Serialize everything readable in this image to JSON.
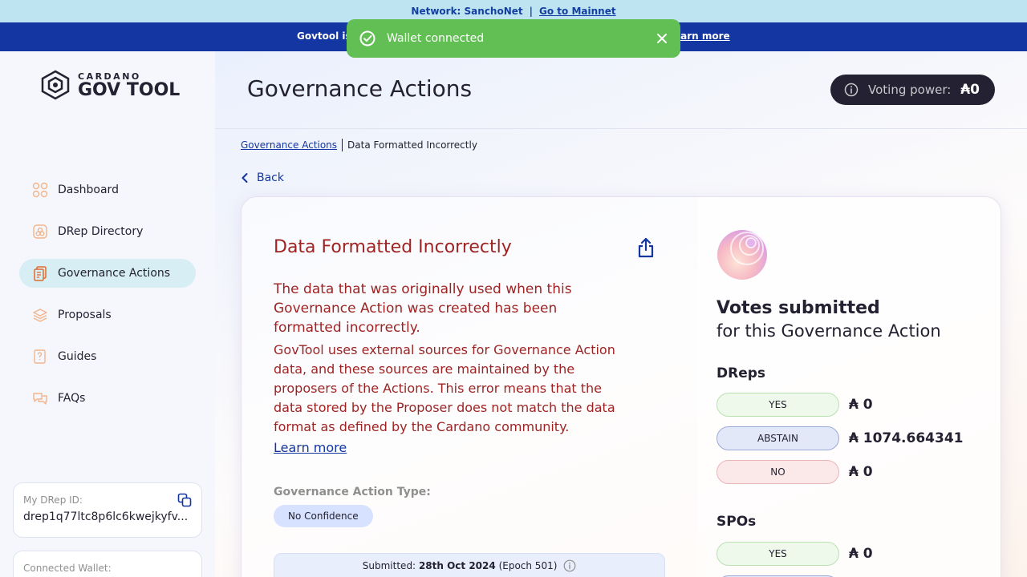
{
  "network_bar": {
    "text": "Network: SanchoNet",
    "separator": "|",
    "link": "Go to Mainnet"
  },
  "banner": {
    "text_left": "Govtool is",
    "text_right": "earn more"
  },
  "toast": {
    "message": "Wallet connected",
    "color": "#62bf54"
  },
  "logo": {
    "top": "CARDANO",
    "bottom": "GOV TOOL"
  },
  "sidebar": {
    "items": [
      {
        "label": "Dashboard",
        "icon": "dashboard-icon",
        "active": false
      },
      {
        "label": "DRep Directory",
        "icon": "drep-directory-icon",
        "active": false
      },
      {
        "label": "Governance Actions",
        "icon": "governance-actions-icon",
        "active": true
      },
      {
        "label": "Proposals",
        "icon": "proposals-icon",
        "active": false
      },
      {
        "label": "Guides",
        "icon": "guides-icon",
        "active": false
      },
      {
        "label": "FAQs",
        "icon": "faqs-icon",
        "active": false
      }
    ],
    "drep_id_label": "My DRep ID:",
    "drep_id_value": "drep1q77ltc8p6lc6kwejkyfv...",
    "wallet_label": "Connected Wallet:"
  },
  "header": {
    "title": "Governance Actions",
    "voting_power_label": "Voting power:",
    "voting_power_value": "₳0"
  },
  "breadcrumb": {
    "parent": "Governance Actions",
    "current": "Data Formatted Incorrectly"
  },
  "back_label": "Back",
  "action": {
    "error_title": "Data Formatted Incorrectly",
    "error_subtitle": "The data that was originally used when this Governance Action was created has been formatted incorrectly.",
    "error_body": "GovTool uses external sources for Governance Action data, and these sources are maintained by the proposers of the Actions. This error means that the data stored by the Proposer does not match the data format as defined by the Cardano community.",
    "learn_more": "Learn more",
    "type_label": "Governance Action Type:",
    "type_value": "No Confidence",
    "submitted_label": "Submitted:",
    "submitted_date": "28th Oct 2024",
    "submitted_epoch": "(Epoch 501)"
  },
  "votes": {
    "title": "Votes submitted",
    "subtitle": "for this Governance Action",
    "dreps": {
      "title": "DReps",
      "rows": [
        {
          "label": "YES",
          "value": "₳ 0"
        },
        {
          "label": "ABSTAIN",
          "value": "₳ 1074.664341"
        },
        {
          "label": "NO",
          "value": "₳ 0"
        }
      ]
    },
    "spos": {
      "title": "SPOs",
      "rows": [
        {
          "label": "YES",
          "value": "₳ 0"
        }
      ]
    }
  }
}
